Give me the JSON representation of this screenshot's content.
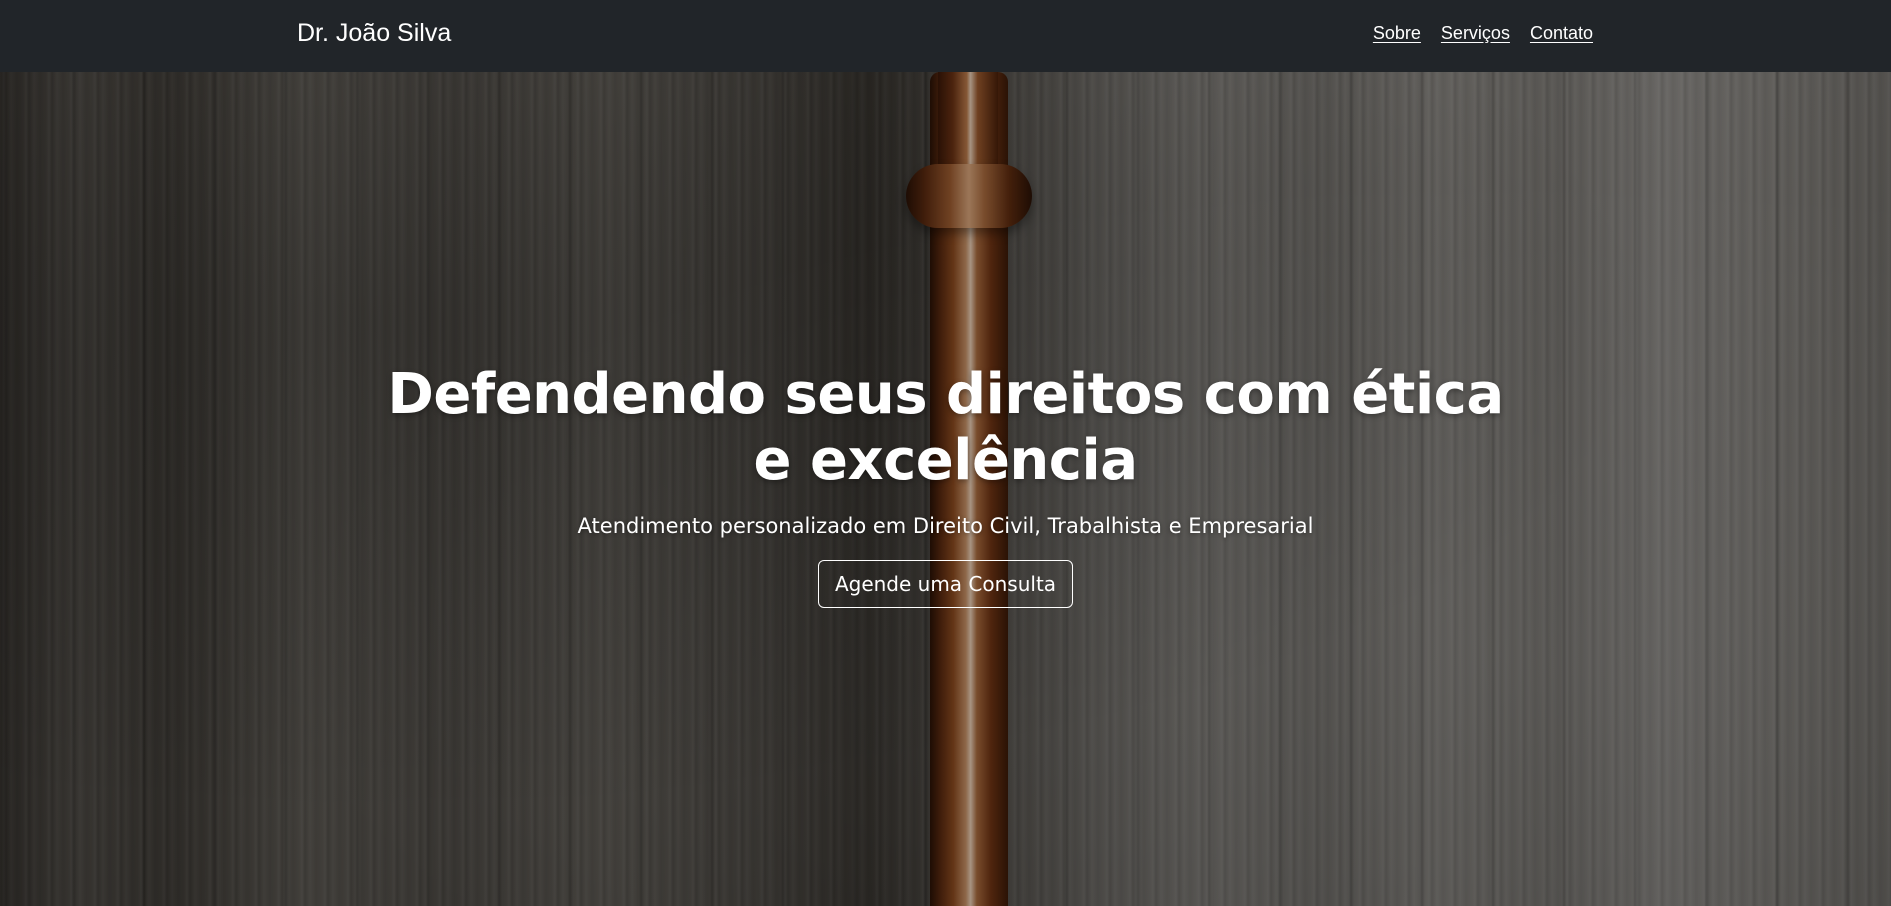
{
  "navbar": {
    "brand": "Dr. João Silva",
    "links": [
      {
        "label": "Sobre"
      },
      {
        "label": "Serviços"
      },
      {
        "label": "Contato"
      }
    ]
  },
  "hero": {
    "title": "Defendendo seus direitos com ética e excelência",
    "subtitle": "Atendimento personalizado em Direito Civil, Trabalhista e Empresarial",
    "cta_label": "Agende uma Consulta"
  },
  "colors": {
    "navbar_bg": "#212529",
    "text": "#ffffff"
  }
}
